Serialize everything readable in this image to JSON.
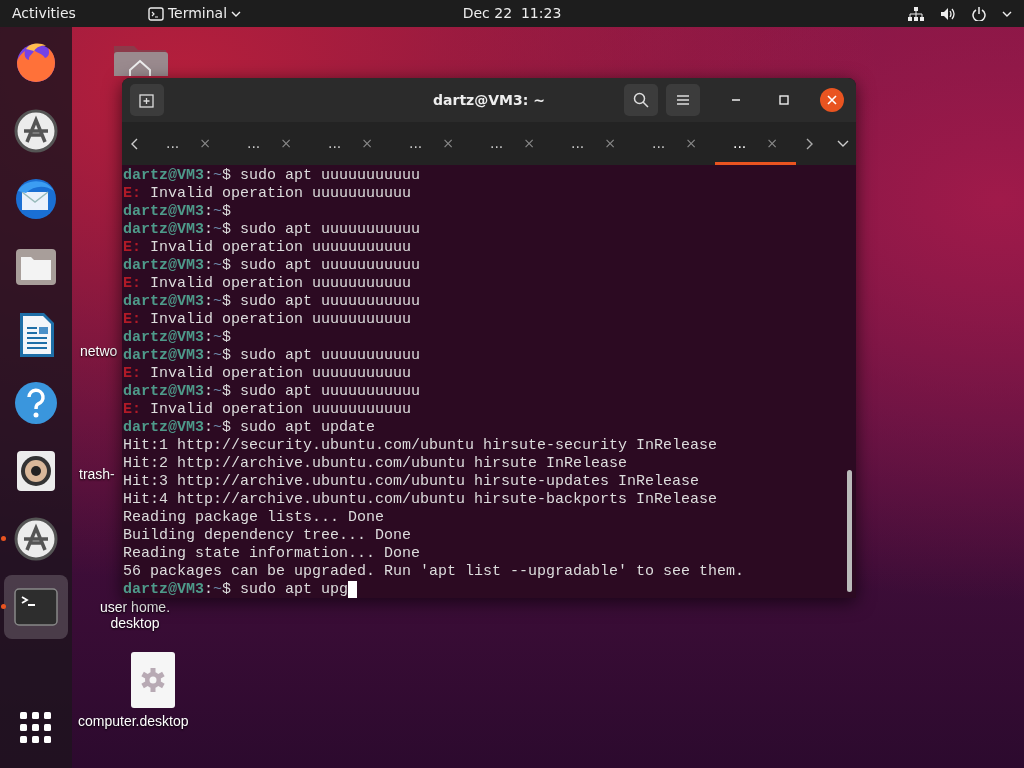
{
  "top_bar": {
    "activities": "Activities",
    "app_menu": "Terminal",
    "clock": "Dec 22  11:23"
  },
  "dock": {
    "items": [
      {
        "kind": "firefox",
        "running": false,
        "active": false
      },
      {
        "kind": "software",
        "running": false,
        "active": false
      },
      {
        "kind": "mail",
        "running": false,
        "active": false
      },
      {
        "kind": "files",
        "running": false,
        "active": false
      },
      {
        "kind": "writer",
        "running": false,
        "active": false
      },
      {
        "kind": "help",
        "running": false,
        "active": false
      },
      {
        "kind": "music",
        "running": false,
        "active": false
      },
      {
        "kind": "software",
        "running": true,
        "active": false
      },
      {
        "kind": "terminal",
        "running": true,
        "active": true
      },
      {
        "kind": "apps",
        "running": false,
        "active": false
      }
    ]
  },
  "desktop_icons": [
    {
      "kind": "home"
    },
    {
      "kind": "hidden",
      "lines": [
        "netwo"
      ]
    },
    {
      "kind": "hidden",
      "lines": [
        "trash-"
      ]
    },
    {
      "kind": "hidden",
      "lines": [
        "user home.",
        "desktop"
      ]
    },
    {
      "kind": "settings",
      "lines": [
        "computer.desktop"
      ]
    }
  ],
  "terminal": {
    "title": "dartz@VM3: ~",
    "tabs": [
      {
        "label": "...",
        "close": "×",
        "selected": false
      },
      {
        "label": "...",
        "close": "×",
        "selected": false
      },
      {
        "label": "...",
        "close": "×",
        "selected": false
      },
      {
        "label": "...",
        "close": "×",
        "selected": false
      },
      {
        "label": "...",
        "close": "×",
        "selected": false
      },
      {
        "label": "...",
        "close": "×",
        "selected": false
      },
      {
        "label": "...",
        "close": "×",
        "selected": false
      },
      {
        "label": "...",
        "close": "×",
        "selected": true
      }
    ],
    "lines": [
      {
        "kind": "prompt",
        "host": "dartz@VM3",
        "sep": ":",
        "path": "~",
        "sign": "$",
        "command": " sudo apt uuuuuuuuuuu",
        "cursor": false
      },
      {
        "kind": "error",
        "label": "E:",
        "text": " Invalid operation uuuuuuuuuuu"
      },
      {
        "kind": "prompt",
        "host": "dartz@VM3",
        "sep": ":",
        "path": "~",
        "sign": "$",
        "cursor": false
      },
      {
        "kind": "prompt",
        "host": "dartz@VM3",
        "sep": ":",
        "path": "~",
        "sign": "$",
        "command": " sudo apt uuuuuuuuuuu",
        "cursor": false
      },
      {
        "kind": "error",
        "label": "E:",
        "text": " Invalid operation uuuuuuuuuuu"
      },
      {
        "kind": "prompt",
        "host": "dartz@VM3",
        "sep": ":",
        "path": "~",
        "sign": "$",
        "command": " sudo apt uuuuuuuuuuu",
        "cursor": false
      },
      {
        "kind": "error",
        "label": "E:",
        "text": " Invalid operation uuuuuuuuuuu"
      },
      {
        "kind": "prompt",
        "host": "dartz@VM3",
        "sep": ":",
        "path": "~",
        "sign": "$",
        "command": " sudo apt uuuuuuuuuuu",
        "cursor": false
      },
      {
        "kind": "error",
        "label": "E:",
        "text": " Invalid operation uuuuuuuuuuu"
      },
      {
        "kind": "prompt",
        "host": "dartz@VM3",
        "sep": ":",
        "path": "~",
        "sign": "$",
        "cursor": false
      },
      {
        "kind": "prompt",
        "host": "dartz@VM3",
        "sep": ":",
        "path": "~",
        "sign": "$",
        "command": " sudo apt uuuuuuuuuuu",
        "cursor": false
      },
      {
        "kind": "error",
        "label": "E:",
        "text": " Invalid operation uuuuuuuuuuu"
      },
      {
        "kind": "prompt",
        "host": "dartz@VM3",
        "sep": ":",
        "path": "~",
        "sign": "$",
        "command": " sudo apt uuuuuuuuuuu",
        "cursor": false
      },
      {
        "kind": "error",
        "label": "E:",
        "text": " Invalid operation uuuuuuuuuuu"
      },
      {
        "kind": "prompt",
        "host": "dartz@VM3",
        "sep": ":",
        "path": "~",
        "sign": "$",
        "command": " sudo apt update",
        "cursor": false
      },
      {
        "kind": "output",
        "text": "Hit:1 http://security.ubuntu.com/ubuntu hirsute-security InRelease"
      },
      {
        "kind": "output",
        "text": "Hit:2 http://archive.ubuntu.com/ubuntu hirsute InRelease"
      },
      {
        "kind": "output",
        "text": "Hit:3 http://archive.ubuntu.com/ubuntu hirsute-updates InRelease"
      },
      {
        "kind": "output",
        "text": "Hit:4 http://archive.ubuntu.com/ubuntu hirsute-backports InRelease"
      },
      {
        "kind": "output",
        "text": "Reading package lists... Done"
      },
      {
        "kind": "output",
        "text": "Building dependency tree... Done"
      },
      {
        "kind": "output",
        "text": "Reading state information... Done"
      },
      {
        "kind": "output",
        "text": "56 packages can be upgraded. Run 'apt list --upgradable' to see them."
      },
      {
        "kind": "prompt",
        "host": "dartz@VM3",
        "sep": ":",
        "path": "~",
        "sign": "$",
        "command": " sudo apt upg",
        "cursor": true
      }
    ]
  }
}
